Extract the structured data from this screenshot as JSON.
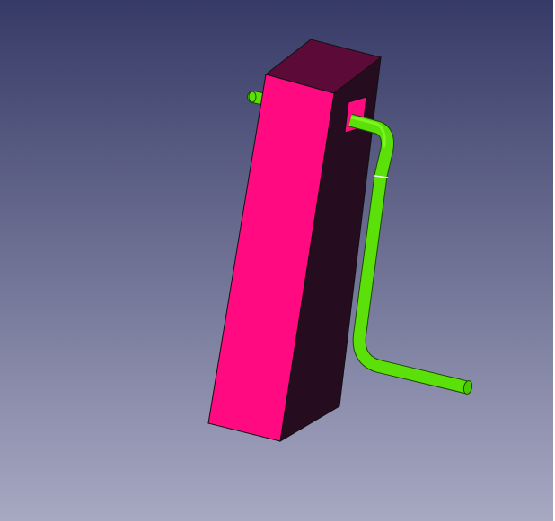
{
  "viewport": {
    "background_top": "#363a66",
    "background_bottom": "#a7a8c2"
  },
  "scene": {
    "box": {
      "front_color": "#ff0a80",
      "side_color": "#250c1f",
      "top_color": "#5c0b38",
      "hole_color": "#ff0a80"
    },
    "pipe": {
      "color": "#5be009",
      "highlight": "#8cff2a",
      "shade": "#2f8f00"
    }
  }
}
